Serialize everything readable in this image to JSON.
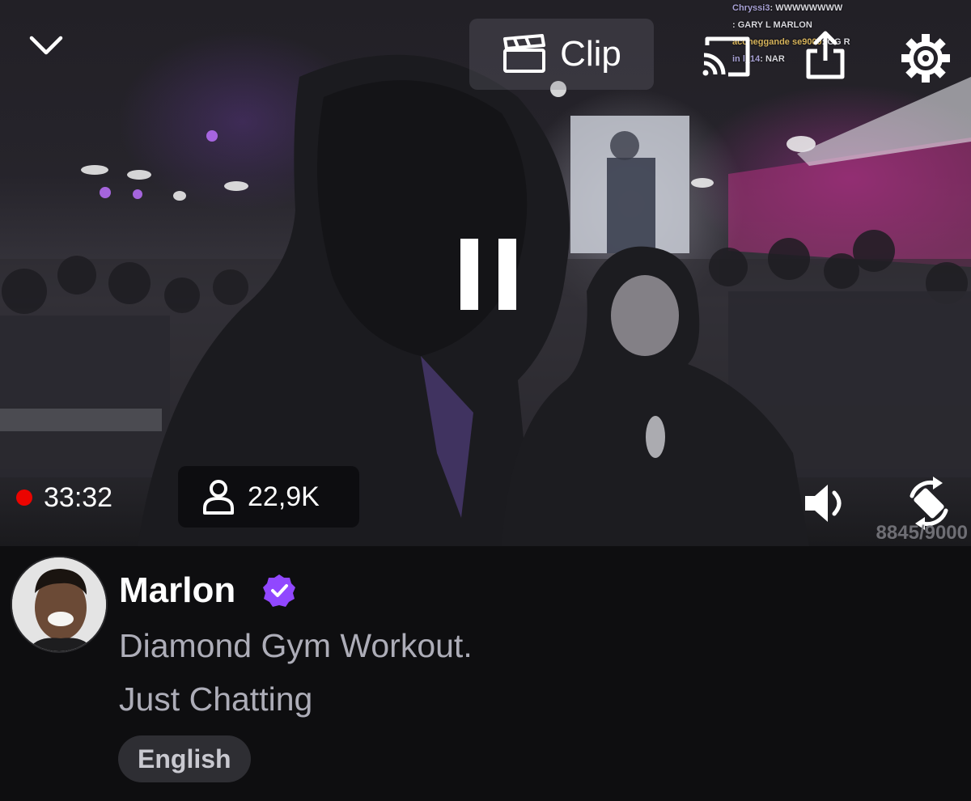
{
  "player": {
    "clip_label": "Clip",
    "uptime": "33:32",
    "viewer_count": "22,9K",
    "bits_counter": "8845/9000",
    "icons": {
      "collapse": "chevron-down-icon",
      "clip": "clapperboard-icon",
      "cast": "cast-icon",
      "share": "share-icon",
      "settings": "gear-icon",
      "pause": "pause-icon",
      "live": "live-dot-icon",
      "viewers": "person-icon",
      "volume": "volume-icon",
      "rotate": "rotate-screen-icon"
    },
    "live_color": "#eb0400"
  },
  "chat_overlay": [
    {
      "user": "Chryssi3",
      "message": "WWWWWWWW"
    },
    {
      "user": "",
      "message": "GARY L MARLON"
    },
    {
      "user": "aconeggande se9000",
      "message": "GG R"
    },
    {
      "user": "in l_14",
      "message": "NAR"
    }
  ],
  "stream": {
    "channel_name": "Marlon",
    "verified": true,
    "title": "Diamond Gym Workout.",
    "category": "Just Chatting",
    "tags": [
      "English"
    ],
    "verified_color": "#9147ff"
  }
}
